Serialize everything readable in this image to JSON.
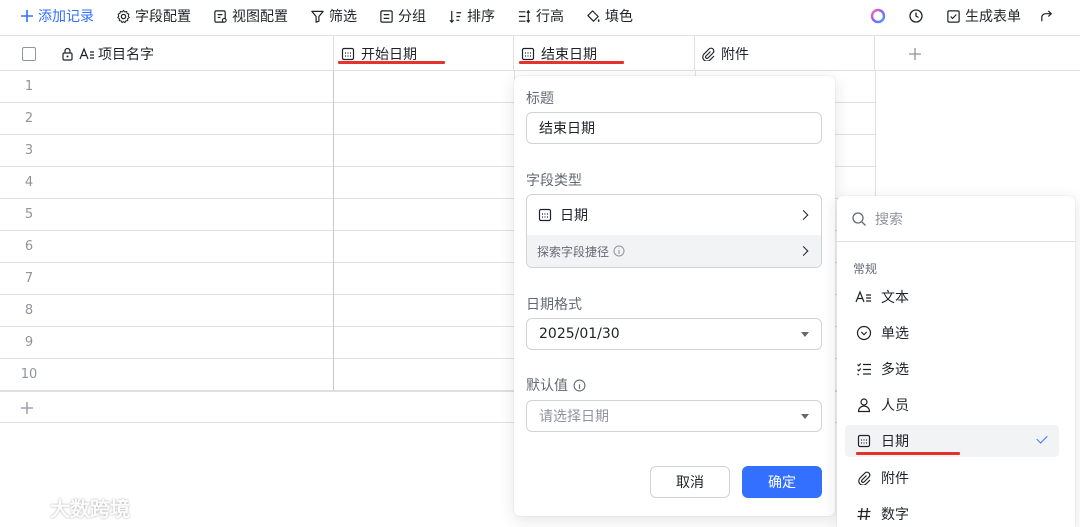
{
  "toolbar": {
    "add_record": "添加记录",
    "field_config": "字段配置",
    "view_config": "视图配置",
    "filter": "筛选",
    "group": "分组",
    "sort": "排序",
    "row_height": "行高",
    "fill": "填色",
    "generate_form": "生成表单"
  },
  "columns": [
    {
      "title": "项目名字"
    },
    {
      "title": "开始日期"
    },
    {
      "title": "结束日期"
    },
    {
      "title": "附件"
    }
  ],
  "rows": [
    "1",
    "2",
    "3",
    "4",
    "5",
    "6",
    "7",
    "8",
    "9",
    "10"
  ],
  "popover": {
    "title_label": "标题",
    "title_value": "结束日期",
    "type_label": "字段类型",
    "type_value": "日期",
    "explore_shortcut": "探索字段捷径",
    "format_label": "日期格式",
    "format_value": "2025/01/30",
    "default_label": "默认值",
    "default_placeholder": "请选择日期",
    "cancel": "取消",
    "confirm": "确定"
  },
  "dropdown": {
    "search_placeholder": "搜索",
    "group_label": "常规",
    "items": [
      {
        "label": "文本",
        "icon": "text-icon"
      },
      {
        "label": "单选",
        "icon": "single-select-icon"
      },
      {
        "label": "多选",
        "icon": "multi-select-icon"
      },
      {
        "label": "人员",
        "icon": "person-icon"
      },
      {
        "label": "日期",
        "icon": "date-icon",
        "selected": true
      },
      {
        "label": "附件",
        "icon": "attachment-icon"
      },
      {
        "label": "数字",
        "icon": "number-icon"
      }
    ]
  },
  "watermark": "大数跨境",
  "colors": {
    "accent": "#3370ff",
    "highlight": "#e5322d",
    "border": "#dee0e3"
  }
}
